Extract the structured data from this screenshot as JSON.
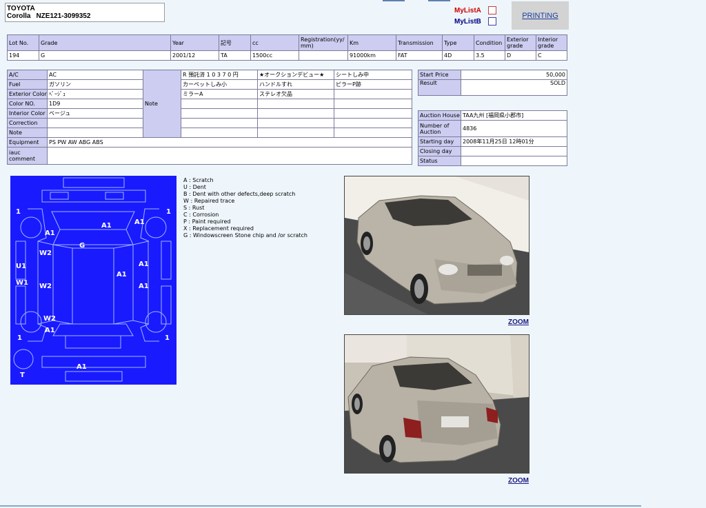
{
  "title": {
    "make": "TOYOTA",
    "model": "Corolla",
    "chassis": "NZE121-3099352"
  },
  "mylist": {
    "a_label": "MyListA",
    "b_label": "MyListB"
  },
  "printing_label": "PRINTING",
  "spec": {
    "headers": [
      "Lot No.",
      "Grade",
      "Year",
      "記号",
      "cc",
      "Registration(yy/ mm)",
      "Km",
      "Transmission",
      "Type",
      "Condition",
      "Exterior grade",
      "Interior grade"
    ],
    "values": [
      "194",
      "G",
      "2001/12",
      "TA",
      "1500cc",
      "",
      "91000km",
      "FAT",
      "4D",
      "3.5",
      "D",
      "C"
    ]
  },
  "details": {
    "ac_label": "A/C",
    "ac": "AC",
    "fuel_label": "Fuel",
    "fuel": "ガソリン",
    "ext_color_label": "Exterior Color",
    "ext_color": "ﾍﾞｰｼﾞｭ",
    "color_no_label": "Color NO.",
    "color_no": "1D9",
    "int_color_label": "Interior Color",
    "int_color": "ベージュ",
    "correction_label": "Correction",
    "correction": "",
    "note_label": "Note",
    "note": "",
    "equipment_label": "Equipment",
    "equipment": "PS PW AW ABG ABS",
    "iauc_label": "iauc comment",
    "iauc": "",
    "note_col_label": "Note",
    "notes": [
      [
        "R 預託済 1 0 3 7 0 円",
        "★オークションデビュー★",
        "シートしみ中"
      ],
      [
        "カーペットしみ小",
        "ハンドルすれ",
        "ピラーP跡"
      ],
      [
        "ミラーA",
        "ステレオ欠品",
        ""
      ],
      [
        "",
        "",
        ""
      ],
      [
        "",
        "",
        ""
      ],
      [
        "",
        "",
        ""
      ],
      [
        "",
        "",
        ""
      ]
    ]
  },
  "price": {
    "start_label": "Start Price",
    "start": "50,000",
    "result_label": "Result",
    "result": "SOLD"
  },
  "auction": {
    "house_label": "Auction House",
    "house": "TAA九州 [福岡県小郡市]",
    "number_label": "Number of Auction",
    "number": "4836",
    "start_label": "Starting day",
    "start": "2008年11月25日 12時01分",
    "closing_label": "Closing day",
    "closing": "",
    "status_label": "Status",
    "status": ""
  },
  "legend": [
    "A  : Scratch",
    "U  : Dent",
    "B  : Dent with other defects,deep scratch",
    "W  : Repaired trace",
    "S  : Rust",
    "C  : Corrosion",
    "P  : Paint required",
    "X  : Replacement required",
    "G  : Windowscreen Stone chip and /or scratch"
  ],
  "diagram_marks": [
    "1",
    "1",
    "A1",
    "A1",
    "A1",
    "G",
    "W2",
    "U1",
    "W1",
    "W2",
    "A1",
    "A1",
    "A1",
    "W2",
    "A1",
    "1",
    "1",
    "A1",
    "T"
  ],
  "zoom_label": "ZOOM",
  "colors": {
    "header_bg": "#cccdf0",
    "diagram_bg": "#1a1aff",
    "page_bg": "#eef6fb"
  }
}
